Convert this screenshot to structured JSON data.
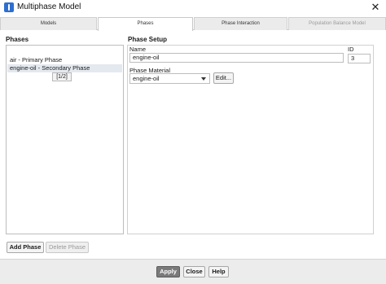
{
  "window": {
    "title": "Multiphase Model",
    "close_glyph": "✕",
    "icon": "app-icon"
  },
  "tabs": [
    {
      "label": "Models"
    },
    {
      "label": "Phases"
    },
    {
      "label": "Phase Interaction"
    },
    {
      "label": "Population Balance Model"
    }
  ],
  "phases": {
    "title": "Phases",
    "items": [
      "air - Primary Phase",
      "engine-oil - Secondary Phase"
    ],
    "tooltip": "[1/2]",
    "add_label": "Add Phase",
    "delete_label": "Delete Phase"
  },
  "setup": {
    "title": "Phase Setup",
    "name_label": "Name",
    "name_value": "engine-oil",
    "id_label": "ID",
    "id_value": "3",
    "material_label": "Phase Material",
    "material_value": "engine-oil",
    "edit_label": "Edit..."
  },
  "footer": {
    "apply_label": "Apply",
    "close_label": "Close",
    "help_label": "Help"
  }
}
